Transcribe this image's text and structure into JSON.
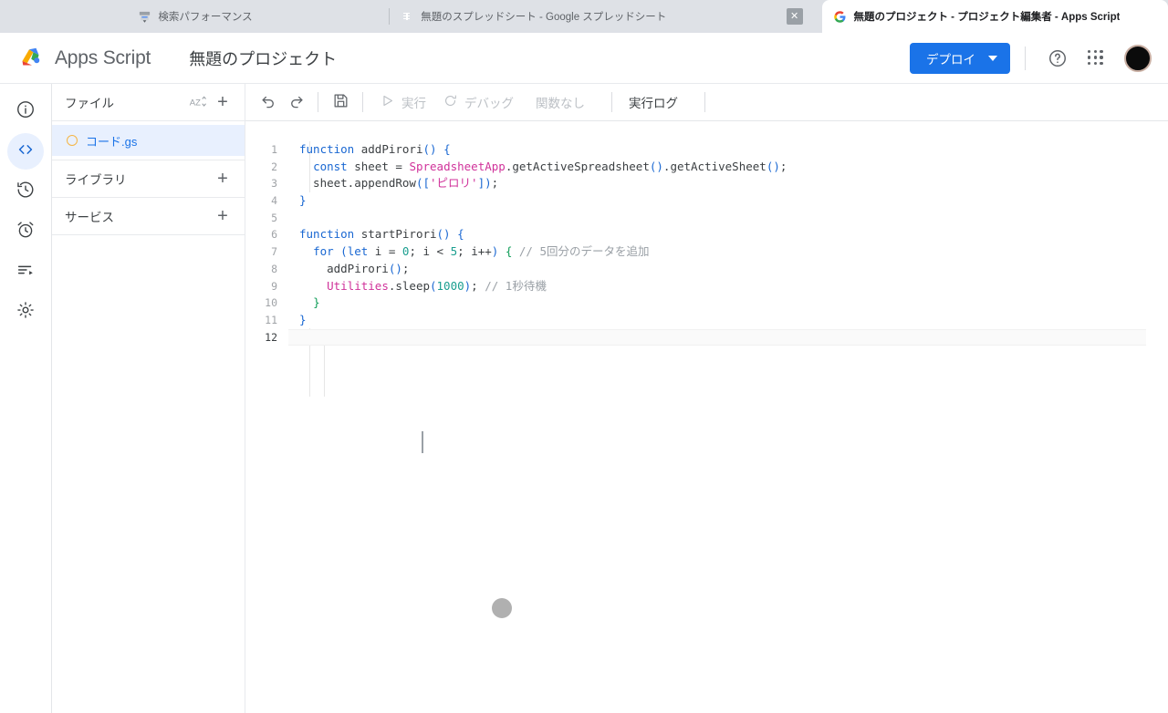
{
  "browser": {
    "tabs": [
      {
        "title": "検索パフォーマンス",
        "favicon": "search-console-icon",
        "active": false,
        "close_label": ""
      },
      {
        "title": "無題のスプレッドシート - Google スプレッドシート",
        "favicon": "google-sheets-icon",
        "active": false,
        "close_label": "✕"
      },
      {
        "title": "無題のプロジェクト - プロジェクト編集者 - Apps Script",
        "favicon": "google-g-icon",
        "active": true,
        "close_label": ""
      }
    ]
  },
  "header": {
    "brand": "Apps Script",
    "logo_name": "apps-script-logo",
    "project_title": "無題のプロジェクト",
    "deploy_label": "デプロイ",
    "help_label": "?",
    "apps_grid_label": "Google アプリ",
    "avatar_label": "アカウント"
  },
  "rail": {
    "items": [
      {
        "name": "overview",
        "icon": "info-circle-icon",
        "active": false
      },
      {
        "name": "editor",
        "icon": "code-brackets-icon",
        "active": true
      },
      {
        "name": "history",
        "icon": "history-clock-icon",
        "active": false
      },
      {
        "name": "triggers",
        "icon": "alarm-clock-icon",
        "active": false
      },
      {
        "name": "executions",
        "icon": "list-play-icon",
        "active": false
      },
      {
        "name": "settings",
        "icon": "gear-icon",
        "active": false
      }
    ]
  },
  "file_panel": {
    "files_header": "ファイル",
    "sort_icon": "sort-az-icon",
    "add_file_icon": "plus-icon",
    "files": [
      {
        "name": "コード.gs",
        "status_icon": "file-status-circle-icon",
        "selected": true
      }
    ],
    "libraries_header": "ライブラリ",
    "services_header": "サービス"
  },
  "toolbar": {
    "undo_icon": "undo-icon",
    "redo_icon": "redo-icon",
    "save_icon": "save-icon",
    "run_label": "実行",
    "run_icon": "play-triangle-icon",
    "debug_label": "デバッグ",
    "debug_icon": "debug-bug-icon",
    "function_select_label": "関数なし",
    "exec_log_label": "実行ログ"
  },
  "editor": {
    "active_line": 12,
    "total_lines": 12,
    "lines": [
      {
        "n": 1,
        "tokens": [
          {
            "t": "function",
            "c": "kw"
          },
          {
            "t": " addPirori",
            "c": "fn"
          },
          {
            "t": "()",
            "c": "brk-b"
          },
          {
            "t": " ",
            "c": "brk"
          },
          {
            "t": "{",
            "c": "brk-b"
          }
        ]
      },
      {
        "n": 2,
        "tokens": [
          {
            "t": "  ",
            "c": "brk"
          },
          {
            "t": "const",
            "c": "kw"
          },
          {
            "t": " sheet ",
            "c": "fn"
          },
          {
            "t": "=",
            "c": "brk"
          },
          {
            "t": " ",
            "c": "brk"
          },
          {
            "t": "SpreadsheetApp",
            "c": "cls"
          },
          {
            "t": ".getActiveSpreadsheet",
            "c": "fn"
          },
          {
            "t": "()",
            "c": "brk-b"
          },
          {
            "t": ".getActiveSheet",
            "c": "fn"
          },
          {
            "t": "()",
            "c": "brk-b"
          },
          {
            "t": ";",
            "c": "brk"
          }
        ]
      },
      {
        "n": 3,
        "tokens": [
          {
            "t": "  sheet.appendRow",
            "c": "fn"
          },
          {
            "t": "([",
            "c": "brk-b"
          },
          {
            "t": "'ピロリ'",
            "c": "str"
          },
          {
            "t": "])",
            "c": "brk-b"
          },
          {
            "t": ";",
            "c": "brk"
          }
        ]
      },
      {
        "n": 4,
        "tokens": [
          {
            "t": "}",
            "c": "brk-b"
          }
        ]
      },
      {
        "n": 5,
        "tokens": [
          {
            "t": "",
            "c": "brk"
          }
        ]
      },
      {
        "n": 6,
        "tokens": [
          {
            "t": "function",
            "c": "kw"
          },
          {
            "t": " startPirori",
            "c": "fn"
          },
          {
            "t": "()",
            "c": "brk-b"
          },
          {
            "t": " ",
            "c": "brk"
          },
          {
            "t": "{",
            "c": "brk-b"
          }
        ]
      },
      {
        "n": 7,
        "tokens": [
          {
            "t": "  ",
            "c": "brk"
          },
          {
            "t": "for",
            "c": "kw"
          },
          {
            "t": " ",
            "c": "brk"
          },
          {
            "t": "(",
            "c": "brk-b"
          },
          {
            "t": "let",
            "c": "kw"
          },
          {
            "t": " i ",
            "c": "fn"
          },
          {
            "t": "=",
            "c": "brk"
          },
          {
            "t": " ",
            "c": "brk"
          },
          {
            "t": "0",
            "c": "num"
          },
          {
            "t": "; i < ",
            "c": "fn"
          },
          {
            "t": "5",
            "c": "num"
          },
          {
            "t": "; i++",
            "c": "fn"
          },
          {
            "t": ")",
            "c": "brk-b"
          },
          {
            "t": " ",
            "c": "brk"
          },
          {
            "t": "{",
            "c": "brk-g"
          },
          {
            "t": " ",
            "c": "brk"
          },
          {
            "t": "// 5回分のデータを追加",
            "c": "com"
          }
        ]
      },
      {
        "n": 8,
        "tokens": [
          {
            "t": "    addPirori",
            "c": "fn"
          },
          {
            "t": "()",
            "c": "brk-b"
          },
          {
            "t": ";",
            "c": "brk"
          }
        ]
      },
      {
        "n": 9,
        "tokens": [
          {
            "t": "    ",
            "c": "brk"
          },
          {
            "t": "Utilities",
            "c": "cls"
          },
          {
            "t": ".sleep",
            "c": "fn"
          },
          {
            "t": "(",
            "c": "brk-b"
          },
          {
            "t": "1000",
            "c": "num"
          },
          {
            "t": ")",
            "c": "brk-b"
          },
          {
            "t": "; ",
            "c": "brk"
          },
          {
            "t": "// 1秒待機",
            "c": "com"
          }
        ]
      },
      {
        "n": 10,
        "tokens": [
          {
            "t": "  ",
            "c": "brk"
          },
          {
            "t": "}",
            "c": "brk-g"
          }
        ]
      },
      {
        "n": 11,
        "tokens": [
          {
            "t": "}",
            "c": "brk-b"
          }
        ]
      },
      {
        "n": 12,
        "tokens": [
          {
            "t": "",
            "c": "brk"
          }
        ]
      }
    ]
  },
  "cursor": {
    "text_caret_name": "text-cursor",
    "mouse_pointer_name": "mouse-pointer-indicator"
  },
  "colors": {
    "accent_blue": "#1a73e8",
    "selection_blue": "#e8f0fe",
    "file_icon_orange": "#f5b544",
    "class_magenta": "#d0329a",
    "number_teal": "#1a9e8f",
    "comment_gray": "#9aa0a6",
    "tabstrip_gray": "#dee1e6"
  }
}
